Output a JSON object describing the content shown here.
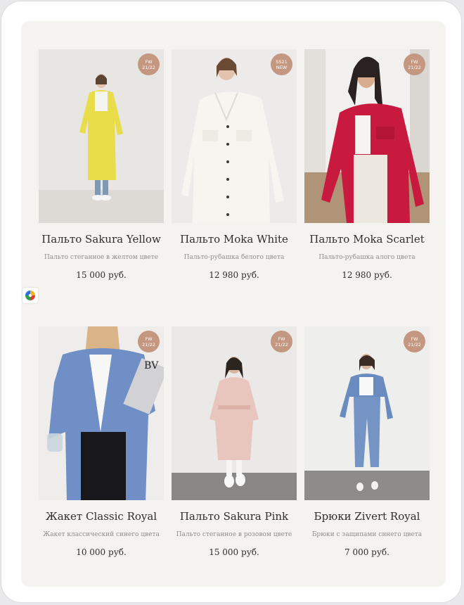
{
  "products": [
    {
      "title": "Пальто Sakura Yellow",
      "description": "Пальто стеганное в желтом цвете",
      "price": "15 000 руб.",
      "badge": [
        "FW",
        "21/22"
      ]
    },
    {
      "title": "Пальто Moka White",
      "description": "Пальто-рубашка белого цвета",
      "price": "12 980 руб.",
      "badge": [
        "SS21",
        "NEW"
      ]
    },
    {
      "title": "Пальто Moka Scarlet",
      "description": "Пальто-рубашка алого цвета",
      "price": "12 980 руб.",
      "badge": [
        "FW",
        "21/22"
      ]
    },
    {
      "title": "Жакет Classic Royal",
      "description": "Жакет классический синего цвета",
      "price": "10 000 руб.",
      "badge": [
        "FW",
        "21/22"
      ]
    },
    {
      "title": "Пальто Sakura Pink",
      "description": "Пальто стеганное в розовом цвете",
      "price": "15 000 руб.",
      "badge": [
        "FW",
        "21/22"
      ]
    },
    {
      "title": "Брюки Zivert Royal",
      "description": "Брюки с защипами синего цвета",
      "price": "7 000 руб.",
      "badge": [
        "FW",
        "21/22"
      ]
    }
  ],
  "floating_widget": {
    "icon": "color-wheel-icon"
  },
  "colors": {
    "badge": "#c49780",
    "panel": "#f4f3f0",
    "text": "#2e2e2e",
    "muted": "#8e8e8e"
  }
}
